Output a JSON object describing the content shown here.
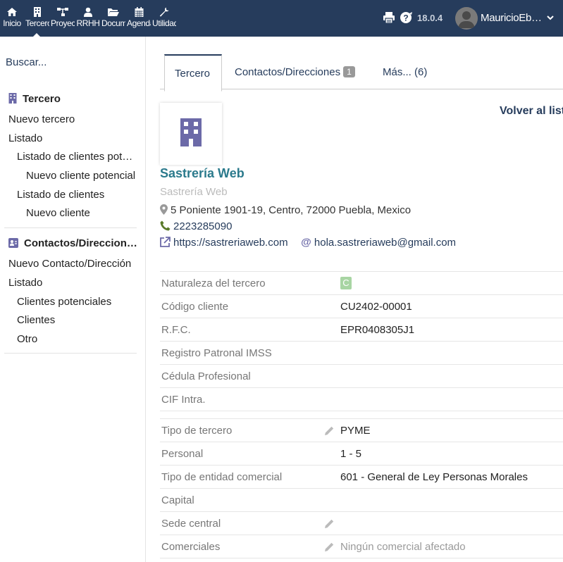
{
  "topbar": {
    "nav": [
      {
        "label": "Inicio",
        "icon": "home-icon"
      },
      {
        "label": "Terceros",
        "icon": "building-icon",
        "active": true
      },
      {
        "label": "Proyectos",
        "icon": "sitemap-icon"
      },
      {
        "label": "RRHH",
        "icon": "user-tie-icon"
      },
      {
        "label": "Documentos",
        "icon": "folder-open-icon"
      },
      {
        "label": "Agenda",
        "icon": "calendar-icon"
      },
      {
        "label": "Utilidades",
        "icon": "wrench-icon"
      }
    ],
    "version": "18.0.4",
    "username": "MauricioEb…"
  },
  "sidebar": {
    "search_placeholder": "Buscar...",
    "sections": [
      {
        "title": "Tercero",
        "items": [
          "Nuevo tercero",
          "Listado",
          "Listado de clientes pote…",
          "Nuevo cliente potencial",
          "Listado de clientes",
          "Nuevo cliente"
        ]
      },
      {
        "title": "Contactos/Direccion…",
        "items": [
          "Nuevo Contacto/Dirección",
          "Listado",
          "Clientes potenciales",
          "Clientes",
          "Otro"
        ]
      }
    ]
  },
  "tabs": [
    {
      "label": "Tercero",
      "active": true
    },
    {
      "label": "Contactos/Direcciones",
      "badge": "1"
    },
    {
      "label": "Más... (6)"
    }
  ],
  "back_link": "Volver al listado",
  "company": {
    "name": "Sastrería Web",
    "alias": "Sastrería Web",
    "address": "5 Poniente 1901-19, Centro, 72000 Puebla, Mexico",
    "phone": "2223285090",
    "website": "https://sastreriaweb.com",
    "email": "hola.sastreriaweb@gmail.com"
  },
  "fields_1": [
    {
      "label": "Naturaleza del tercero",
      "value": "C",
      "tag": true
    },
    {
      "label": "Código cliente",
      "value": "CU2402-00001"
    },
    {
      "label": "R.F.C.",
      "value": "EPR0408305J1"
    },
    {
      "label": "Registro Patronal IMSS",
      "value": ""
    },
    {
      "label": "Cédula Profesional",
      "value": ""
    },
    {
      "label": "CIF Intra.",
      "value": ""
    }
  ],
  "fields_2": [
    {
      "label": "Tipo de tercero",
      "value": "PYME",
      "editable": true
    },
    {
      "label": "Personal",
      "value": "1 - 5"
    },
    {
      "label": "Tipo de entidad comercial",
      "value": "601 - General de Ley Personas Morales"
    },
    {
      "label": "Capital",
      "value": ""
    },
    {
      "label": "Sede central",
      "value": "",
      "editable": true
    },
    {
      "label": "Comerciales",
      "value": "Ningún comercial afectado",
      "editable": true,
      "muted": true
    }
  ],
  "colors": {
    "topbar": "#263c5c",
    "accent": "#263c5c",
    "company_name": "#2b7a8c",
    "icon_purple": "#6c6aa8",
    "phone_green": "#5a7a2a"
  }
}
